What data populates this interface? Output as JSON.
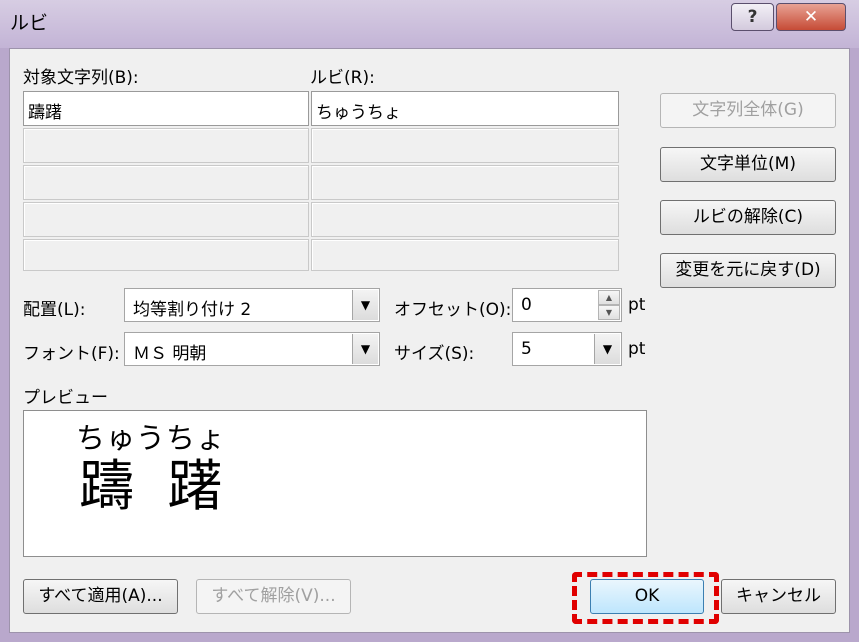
{
  "window": {
    "title": "ルビ",
    "help_label": "?",
    "close_label": "✕"
  },
  "grid": {
    "base_header": "対象文字列(B):",
    "ruby_header": "ルビ(R):",
    "rows": [
      {
        "base": "躊躇",
        "ruby": "ちゅうちょ"
      },
      {
        "base": "",
        "ruby": ""
      },
      {
        "base": "",
        "ruby": ""
      },
      {
        "base": "",
        "ruby": ""
      },
      {
        "base": "",
        "ruby": ""
      }
    ]
  },
  "side_buttons": {
    "whole_string": "文字列全体(G)",
    "per_char": "文字単位(M)",
    "remove_ruby": "ルビの解除(C)",
    "revert": "変更を元に戻す(D)"
  },
  "options": {
    "alignment_label": "配置(L):",
    "alignment_value": "均等割り付け 2",
    "font_label": "フォント(F):",
    "font_value": "ＭＳ 明朝",
    "offset_label": "オフセット(O):",
    "offset_value": "0",
    "offset_unit": "pt",
    "size_label": "サイズ(S):",
    "size_value": "5",
    "size_unit": "pt"
  },
  "preview": {
    "label": "プレビュー",
    "ruby": "ちゅうちょ",
    "base": "躊 躇"
  },
  "footer": {
    "apply_all": "すべて適用(A)...",
    "remove_all": "すべて解除(V)...",
    "ok": "OK",
    "cancel": "キャンセル"
  },
  "icons": {
    "dropdown": "▼",
    "spin_up": "▲",
    "spin_down": "▼"
  },
  "colors": {
    "highlight": "#e00000",
    "ok_button": "#bee6fd"
  }
}
